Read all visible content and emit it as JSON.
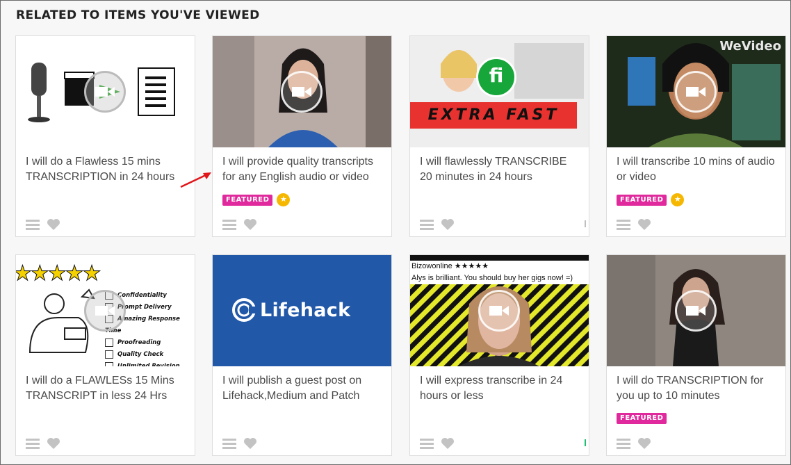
{
  "section_title": "RELATED TO ITEMS YOU'VE VIEWED",
  "colors": {
    "featured": "#e0299c",
    "accent_star": "#f6b700",
    "green": "#1dbf73"
  },
  "gigs": [
    {
      "title": "I will do a Flawless 15 mins TRANSCRIPTION in 24 hours",
      "featured": false,
      "top_rated": false
    },
    {
      "title": "I will provide quality transcripts for any English audio or video",
      "featured": true,
      "top_rated": true
    },
    {
      "title": "I will flawlessly TRANSCRIBE 20 minutes in 24 hours",
      "featured": false,
      "top_rated": false,
      "thumb_text": "EXTRA FAST",
      "thumb_badge": "fi"
    },
    {
      "title": "I will transcribe 10 mins of audio or video",
      "featured": true,
      "top_rated": true,
      "thumb_text": "WeVideo"
    },
    {
      "title": "I will do a FLAWLESs 15 Mins TRANSCRIPT in less 24 Hrs",
      "featured": false,
      "top_rated": false,
      "thumb_checklist": [
        "Confidentiality",
        "Prompt Delivery",
        "Amazing Response Time",
        "Proofreading",
        "Quality Check",
        "Unlimited Revision"
      ]
    },
    {
      "title": "I will publish a guest post on Lifehack,Medium and Patch",
      "featured": false,
      "top_rated": false,
      "thumb_text": "Lifehack"
    },
    {
      "title": "I will express transcribe in 24 hours or less",
      "featured": false,
      "top_rated": false,
      "thumb_caption_1": "Bizowonline ★★★★★",
      "thumb_caption_2": "Alys is brilliant. You should buy her gigs now! =)"
    },
    {
      "title": "I will do TRANSCRIPTION for you up to 10 minutes",
      "featured": true,
      "top_rated": false
    }
  ],
  "badge_label": "FEATURED",
  "icons": [
    "menu-icon",
    "heart-icon",
    "video-play-icon",
    "star-icon"
  ]
}
